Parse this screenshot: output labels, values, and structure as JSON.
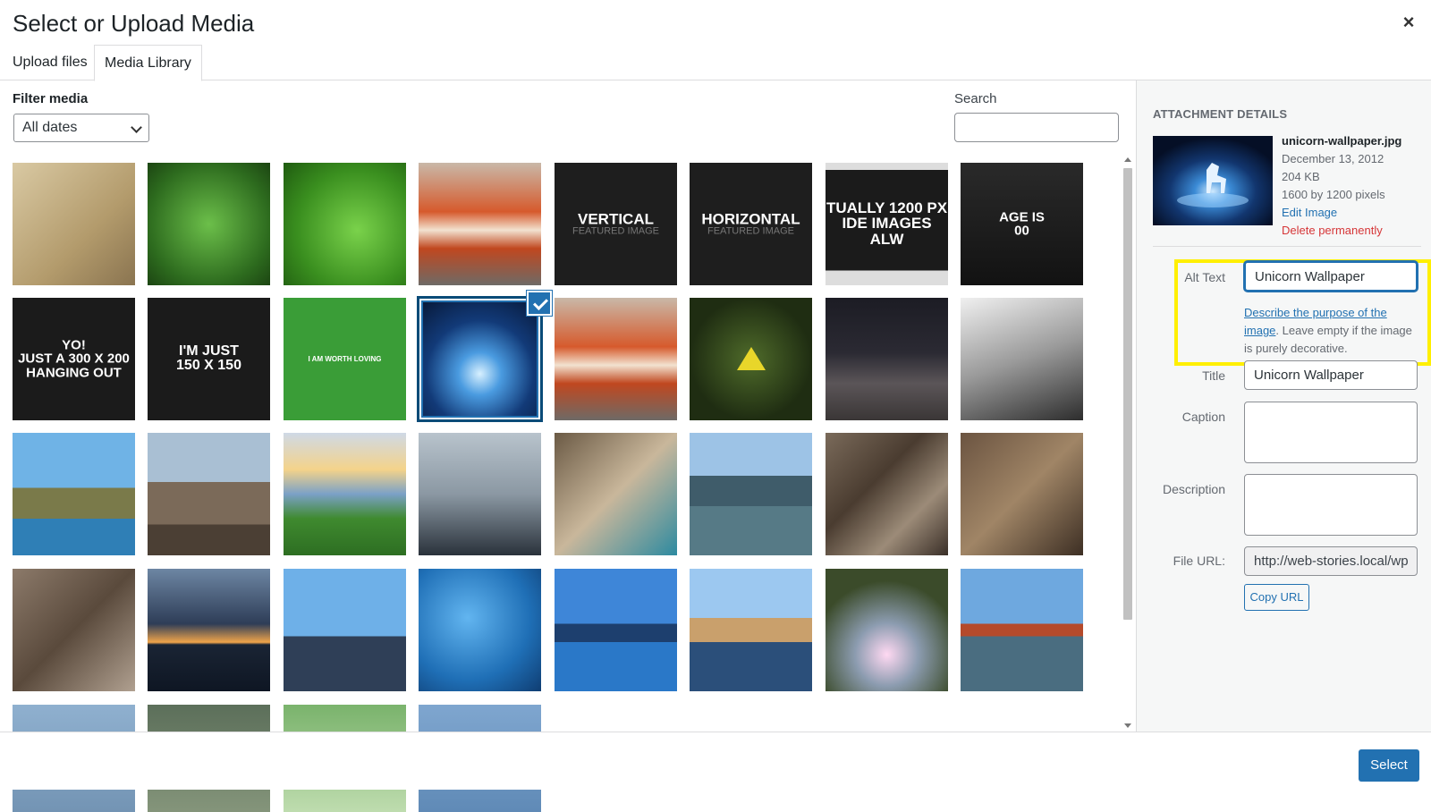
{
  "modal": {
    "title": "Select or Upload Media",
    "close_label": "×"
  },
  "tabs": [
    {
      "label": "Upload files",
      "active": false
    },
    {
      "label": "Media Library",
      "active": true
    }
  ],
  "filter": {
    "label": "Filter media",
    "selected": "All dates"
  },
  "search": {
    "label": "Search",
    "value": ""
  },
  "grid": {
    "items": [
      {
        "desc": "glasses-on-paper",
        "text": "",
        "selected": false
      },
      {
        "desc": "green-fern",
        "text": "",
        "selected": false
      },
      {
        "desc": "leaf-waterdrops",
        "text": "",
        "selected": false
      },
      {
        "desc": "coral-rock",
        "text": "",
        "selected": false
      },
      {
        "desc": "vertical-featured",
        "text": "VERTICAL",
        "sub": "FEATURED IMAGE",
        "selected": false
      },
      {
        "desc": "horizontal-featured",
        "text": "HORIZONTAL",
        "sub": "FEATURED IMAGE",
        "selected": false
      },
      {
        "desc": "wide-banner",
        "text": "TUALLY 1200 PX",
        "sub": "IDE IMAGES ALW",
        "selected": false
      },
      {
        "desc": "dark-cropped",
        "text": "AGE IS",
        "sub": "00",
        "selected": false
      },
      {
        "desc": "yo-300x200",
        "text": "YO!",
        "sub": "JUST A 300 X 200\nHANGING OUT",
        "selected": false
      },
      {
        "desc": "im-just-150",
        "text": "I'M JUST",
        "sub": "150 X 150",
        "selected": false
      },
      {
        "desc": "worth-loving",
        "text": "I AM WORTH LOVING",
        "selected": false
      },
      {
        "desc": "unicorn",
        "text": "",
        "selected": true
      },
      {
        "desc": "coral-rock-2",
        "text": "",
        "selected": false
      },
      {
        "desc": "triforce",
        "text": "",
        "selected": false
      },
      {
        "desc": "city-street",
        "text": "",
        "selected": false
      },
      {
        "desc": "bw-rock",
        "text": "",
        "selected": false
      },
      {
        "desc": "coast-cliff",
        "text": "",
        "selected": false
      },
      {
        "desc": "rock-arch-sunset",
        "text": "",
        "selected": false
      },
      {
        "desc": "sunset-coast",
        "text": "",
        "selected": false
      },
      {
        "desc": "foggy-sea",
        "text": "",
        "selected": false
      },
      {
        "desc": "waterfall-beach",
        "text": "",
        "selected": false
      },
      {
        "desc": "sea-rocks",
        "text": "",
        "selected": false
      },
      {
        "desc": "rail-tracks",
        "text": "",
        "selected": false
      },
      {
        "desc": "orange-lilies",
        "text": "",
        "selected": false
      },
      {
        "desc": "wagon-wheel",
        "text": "",
        "selected": false
      },
      {
        "desc": "cloud-sunset",
        "text": "",
        "selected": false
      },
      {
        "desc": "harbour-bridge",
        "text": "",
        "selected": false
      },
      {
        "desc": "rain-water",
        "text": "",
        "selected": false
      },
      {
        "desc": "marina",
        "text": "",
        "selected": false
      },
      {
        "desc": "wooden-pier",
        "text": "",
        "selected": false
      },
      {
        "desc": "forest-light",
        "text": "",
        "selected": false
      },
      {
        "desc": "golden-gate",
        "text": "",
        "selected": false
      },
      {
        "desc": "partial-1",
        "text": "",
        "selected": false
      },
      {
        "desc": "partial-2",
        "text": "",
        "selected": false
      },
      {
        "desc": "partial-3",
        "text": "",
        "selected": false
      },
      {
        "desc": "partial-4",
        "text": "",
        "selected": false
      }
    ]
  },
  "details": {
    "heading": "Attachment Details",
    "filename": "unicorn-wallpaper.jpg",
    "date": "December 13, 2012",
    "size": "204 KB",
    "dimensions": "1600 by 1200 pixels",
    "edit_label": "Edit Image",
    "delete_label": "Delete permanently",
    "alt_label": "Alt Text",
    "alt_value": "Unicorn Wallpaper",
    "alt_help_link": "Describe the purpose of the image",
    "alt_help_text": ". Leave empty if the image is purely decorative.",
    "title_label": "Title",
    "title_value": "Unicorn Wallpaper",
    "caption_label": "Caption",
    "caption_value": "",
    "description_label": "Description",
    "description_value": "",
    "url_label": "File URL:",
    "url_value": "http://web-stories.local/wp",
    "copy_label": "Copy URL"
  },
  "footer": {
    "select_label": "Select"
  },
  "colors": {
    "accent": "#2271b1",
    "danger": "#d63638",
    "highlight": "#ffef00"
  }
}
